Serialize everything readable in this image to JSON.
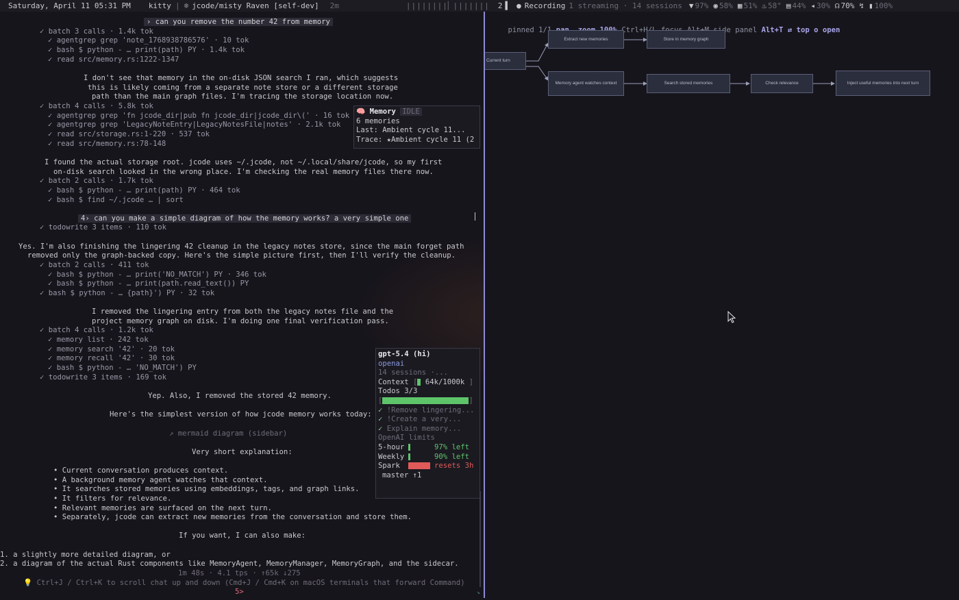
{
  "statusbar": {
    "datetime": "Saturday, April 11 05:31 PM",
    "app": "kitty",
    "title": "jcode/misty Raven [self-dev]",
    "elapsed": "2m",
    "workspace": "2",
    "recording": "Recording",
    "streaming": "1 streaming · 14 sessions",
    "wifi": "97%",
    "cpu": "58%",
    "mem": "51%",
    "temp": "58°",
    "disk": "44%",
    "volume": "30%",
    "headphones": "70%",
    "battery": "100%"
  },
  "chat": {
    "lines": [
      {
        "t": "› can you remove the number 42 from memory",
        "kind": "user-prev"
      },
      {
        "t": "✓ batch 3 calls · 1.4k tok",
        "kind": "batch"
      },
      {
        "t": "✓ agentgrep grep 'note_1768938786576' · 10 tok",
        "kind": "tool"
      },
      {
        "t": "✓ bash $ python - … print(path) PY · 1.4k tok",
        "kind": "tool"
      },
      {
        "t": "✓ read src/memory.rs:1222-1347",
        "kind": "tool"
      },
      {
        "t": "I don't see that memory in the on-disk JSON search I ran, which suggests",
        "kind": "text"
      },
      {
        "t": "this is likely coming from a separate note store or a different storage",
        "kind": "text"
      },
      {
        "t": "path than the main graph files. I'm tracing the storage location now.",
        "kind": "text"
      },
      {
        "t": "✓ batch 4 calls · 5.8k tok",
        "kind": "batch"
      },
      {
        "t": "✓ agentgrep grep 'fn jcode_dir|pub fn jcode_dir|jcode_dir\\(' · 16 tok",
        "kind": "tool"
      },
      {
        "t": "✓ agentgrep grep 'LegacyNoteEntry|LegacyNotesFile|notes' · 2.1k tok",
        "kind": "tool"
      },
      {
        "t": "✓ read src/storage.rs:1-220 · 537 tok",
        "kind": "tool"
      },
      {
        "t": "✓ read src/memory.rs:78-148",
        "kind": "tool"
      },
      {
        "t": "I found the actual storage root. jcode uses ~/.jcode, not ~/.local/share/jcode, so my first",
        "kind": "text"
      },
      {
        "t": "on-disk search looked in the wrong place. I'm checking the real memory files there now.",
        "kind": "text"
      },
      {
        "t": "✓ batch 2 calls · 1.7k tok",
        "kind": "batch"
      },
      {
        "t": "✓ bash $ python - … print(path) PY · 464 tok",
        "kind": "tool"
      },
      {
        "t": "✓ bash $ find ~/.jcode … | sort",
        "kind": "tool"
      },
      {
        "t": "4› can you make a simple diagram of how the memory works? a very simple one",
        "kind": "user"
      },
      {
        "t": "✓ todowrite 3 items · 110 tok",
        "kind": "batch"
      },
      {
        "t": "Yes. I'm also finishing the lingering 42 cleanup in the legacy notes store, since the main forget path",
        "kind": "text"
      },
      {
        "t": "removed only the graph-backed copy. Here's the simple picture first, then I'll verify the cleanup.",
        "kind": "text"
      },
      {
        "t": "✓ batch 2 calls · 411 tok",
        "kind": "batch"
      },
      {
        "t": "✓ bash $ python - … print('NO_MATCH') PY · 346 tok",
        "kind": "tool"
      },
      {
        "t": "✓ bash $ python - … print(path.read_text()) PY",
        "kind": "tool"
      },
      {
        "t": "✓ bash $ python - … {path}') PY · 32 tok",
        "kind": "batch"
      },
      {
        "t": "I removed the lingering entry from both the legacy notes file and the",
        "kind": "text"
      },
      {
        "t": "project memory graph on disk. I'm doing one final verification pass.",
        "kind": "text"
      },
      {
        "t": "✓ batch 4 calls · 1.2k tok",
        "kind": "batch"
      },
      {
        "t": "✓ memory list · 242 tok",
        "kind": "tool"
      },
      {
        "t": "✓ memory search '42' · 20 tok",
        "kind": "tool"
      },
      {
        "t": "✓ memory recall '42' · 30 tok",
        "kind": "tool"
      },
      {
        "t": "✓ bash $ python - … 'NO_MATCH') PY",
        "kind": "tool"
      },
      {
        "t": "✓ todowrite 3 items · 169 tok",
        "kind": "batch"
      },
      {
        "t": "Yep. Also, I removed the stored 42 memory.",
        "kind": "text"
      },
      {
        "t": "Here's the simplest version of how jcode memory works today:",
        "kind": "text"
      },
      {
        "t": "↗ mermaid diagram (sidebar)",
        "kind": "dim"
      },
      {
        "t": "Very short explanation:",
        "kind": "text"
      },
      {
        "t": "• Current conversation produces context.",
        "kind": "bullet"
      },
      {
        "t": "• A background memory agent watches that context.",
        "kind": "bullet"
      },
      {
        "t": "• It searches stored memories using embeddings, tags, and graph links.",
        "kind": "bullet"
      },
      {
        "t": "• It filters for relevance.",
        "kind": "bullet"
      },
      {
        "t": "• Relevant memories are surfaced on the next turn.",
        "kind": "bullet"
      },
      {
        "t": "• Separately, jcode can extract new memories from the conversation and store them.",
        "kind": "bullet"
      },
      {
        "t": "If you want, I can also make:",
        "kind": "text"
      },
      {
        "t": "1. a slightly more detailed diagram, or",
        "kind": "list"
      },
      {
        "t": "2. a diagram of the actual Rust components like MemoryAgent, MemoryManager, MemoryGraph, and the sidecar.",
        "kind": "list"
      },
      {
        "t": "1m 48s · 4.1 tps · ↑65k ↓275",
        "kind": "dim"
      },
      {
        "t": "💡 Ctrl+J / Ctrl+K to scroll chat up and down (Cmd+J / Cmd+K on macOS terminals that forward Command)",
        "kind": "dim"
      },
      {
        "t": "5>",
        "kind": "prompt"
      }
    ]
  },
  "memory_panel": {
    "title": "Memory",
    "state": "IDLE",
    "count": "6 memories",
    "last": "Last: Ambient cycle 11...",
    "trace": "Trace: ★Ambient cycle 11 (2"
  },
  "info_panel": {
    "model": "gpt-5.4 (hi)",
    "provider": "openai",
    "sessions": "14 sessions ·...",
    "context_label": "Context",
    "context_value": "64k/1000k",
    "context_fraction": 0.064,
    "todos_label": "Todos 3/3",
    "todos_fraction": 1.0,
    "todos": [
      "!Remove lingering...",
      "!Create a very...",
      "Explain memory..."
    ],
    "limits_title": "OpenAI limits",
    "limits": [
      {
        "name": "5-hour",
        "value": "97% left",
        "fraction": 0.03,
        "color": "#5ec46a"
      },
      {
        "name": "Weekly",
        "value": "90% left",
        "fraction": 0.1,
        "color": "#5ec46a"
      },
      {
        "name": "Spark",
        "value": "resets 3h",
        "fraction": 1.0,
        "color": "#e05a5a"
      }
    ],
    "branch": "master ↑1"
  },
  "side_panel": {
    "header": {
      "pinned": "pinned 1/1",
      "pan": "pan",
      "zoom": "zoom 100%",
      "zoom_keys": "Ctrl+H/L",
      "focus": "focus Alt+M",
      "side_panel": "side panel",
      "alt_t": "Alt+T",
      "top": "⇄ top",
      "open": "o open"
    },
    "diagram_nodes": [
      {
        "id": "n0",
        "label": "Current turn"
      },
      {
        "id": "n1",
        "label": "Extract new memories"
      },
      {
        "id": "n2",
        "label": "Store in memory graph"
      },
      {
        "id": "n3",
        "label": "Memory agent watches context"
      },
      {
        "id": "n4",
        "label": "Search stored memories"
      },
      {
        "id": "n5",
        "label": "Check relevance"
      },
      {
        "id": "n6",
        "label": "Inject useful memories into next turn"
      }
    ]
  },
  "colors": {
    "accent": "#8f8bd6",
    "check": "#7fc98b",
    "highlight_num": "#c9a24a",
    "node_bg": "#2b2e3c"
  }
}
